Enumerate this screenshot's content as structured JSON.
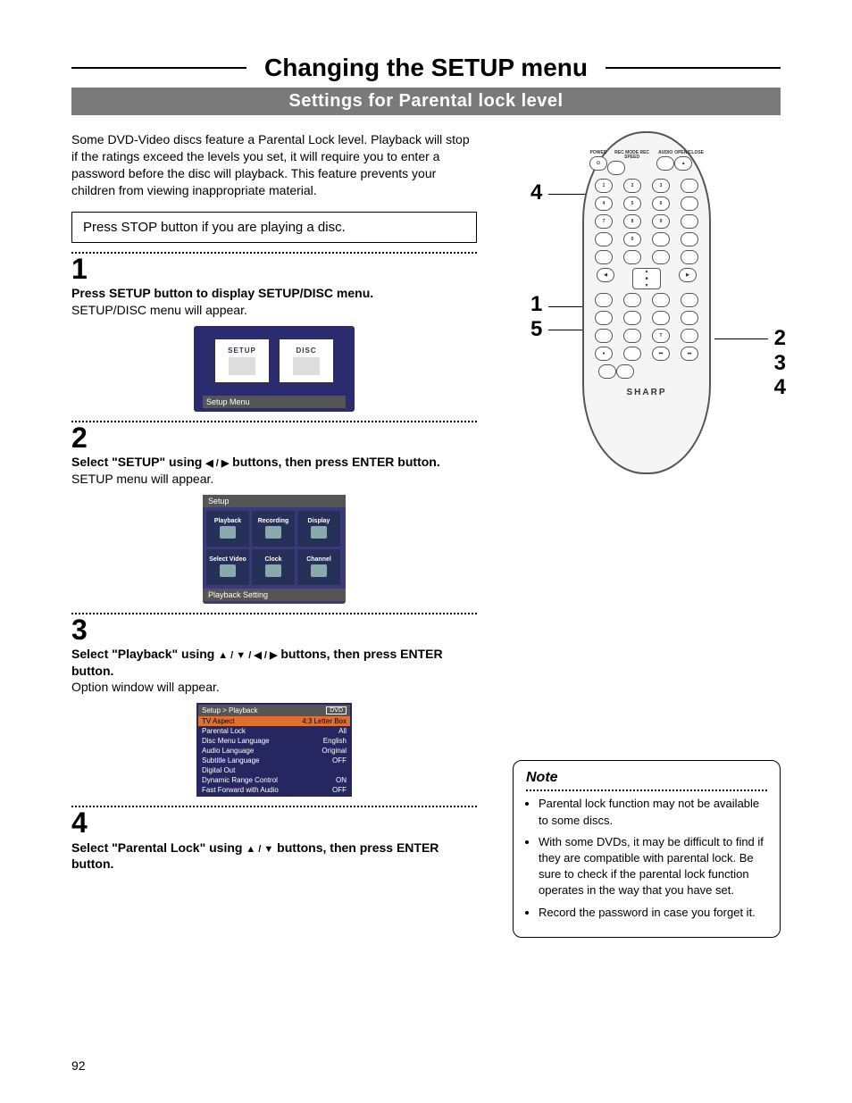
{
  "title": "Changing the SETUP menu",
  "subtitle": "Settings for Parental lock level",
  "intro": "Some DVD-Video discs feature a Parental Lock level. Playback will stop if the ratings exceed the levels you set, it will require you to enter a password before the disc will playback. This feature prevents your children from viewing inappropriate material.",
  "press_box": "Press STOP button if you are playing a disc.",
  "steps": {
    "s1_num": "1",
    "s1_title": "Press SETUP button to display SETUP/DISC menu.",
    "s1_sub": "SETUP/DISC menu will appear.",
    "s2_num": "2",
    "s2_title_pre": "Select \"SETUP\" using ",
    "s2_title_post": " buttons, then press ENTER button.",
    "s2_sub": "SETUP menu will appear.",
    "s3_num": "3",
    "s3_title_pre": "Select \"Playback\" using ",
    "s3_title_post": " buttons, then press ENTER button.",
    "s3_sub": "Option window will appear.",
    "s4_num": "4",
    "s4_title_pre": "Select \"Parental Lock\" using ",
    "s4_title_post": " buttons, then press ENTER button."
  },
  "setup_menu": {
    "card1": "SETUP",
    "card2": "DISC",
    "footer": "Setup Menu"
  },
  "grid_menu": {
    "header": "Setup",
    "cells": [
      "Playback",
      "Recording",
      "Display",
      "Select Video",
      "Clock",
      "Channel"
    ],
    "footer": "Playback Setting"
  },
  "pb_menu": {
    "header": "Setup > Playback",
    "badge": "DVD",
    "rows": [
      {
        "k": "TV Aspect",
        "v": "4:3 Letter Box"
      },
      {
        "k": "Parental Lock",
        "v": "All"
      },
      {
        "k": "Disc Menu Language",
        "v": "English"
      },
      {
        "k": "Audio Language",
        "v": "Original"
      },
      {
        "k": "Subtitle Language",
        "v": "OFF"
      },
      {
        "k": "Digital Out",
        "v": ""
      },
      {
        "k": "Dynamic Range Control",
        "v": "ON"
      },
      {
        "k": "Fast Forward with Audio",
        "v": "OFF"
      }
    ]
  },
  "remote": {
    "brand": "SHARP",
    "callouts_left": [
      "4",
      "1",
      "5"
    ],
    "callouts_right": [
      "2",
      "3",
      "4"
    ],
    "top_labels": [
      "POWER",
      "REC MODE REC SPEED",
      "AUDIO",
      "OPEN/CLOSE"
    ]
  },
  "note": {
    "title": "Note",
    "items": [
      "Parental lock function may not be available to some discs.",
      "With some DVDs, it may be difficult to find if they are compatible with parental lock. Be sure to check if the parental lock function operates in the way that you have set.",
      "Record the password in case you forget it."
    ]
  },
  "page_number": "92"
}
